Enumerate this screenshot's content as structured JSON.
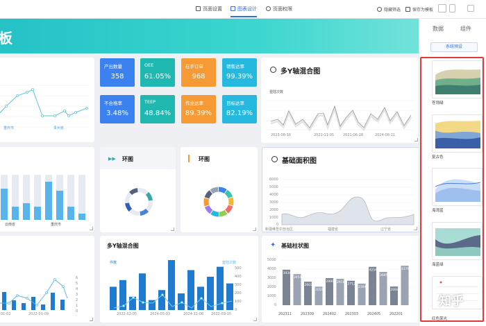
{
  "topbar": {
    "tabs": [
      "页面设置",
      "图表设计",
      "页面权限"
    ],
    "hide_filter": "隐藏筛选",
    "save_template": "保存为模板"
  },
  "banner": {
    "title": "板"
  },
  "line_panel": {
    "x_labels": [
      "重庆市",
      "贵州省"
    ]
  },
  "kpis": [
    {
      "label": "产出数量",
      "value": "358",
      "color": "#3b82f0"
    },
    {
      "label": "OEE",
      "value": "61.05%",
      "color": "#1fb8b0"
    },
    {
      "label": "在手订单",
      "value": "968",
      "color": "#f59a35"
    },
    {
      "label": "销售达率",
      "value": "99.39%",
      "color": "#26b9df"
    },
    {
      "label": "不合格率",
      "value": "3.48%",
      "color": "#3b82f0"
    },
    {
      "label": "TEEP",
      "value": "48.84%",
      "color": "#1fb8b0"
    },
    {
      "label": "作业达率",
      "value": "89.39%",
      "color": "#f59a35"
    },
    {
      "label": "目标达率",
      "value": "82.19%",
      "color": "#26b9df"
    }
  ],
  "multi_y_top": {
    "title": "多Y轴混合图",
    "series_label": "登陆次数",
    "x_labels": [
      "2023-08-16",
      "2021-11-05",
      "2021-06-28",
      "2024-08-21"
    ]
  },
  "bar_left": {
    "x_labels": [
      "云南省",
      "重庆市"
    ]
  },
  "ring1": {
    "title": "环图",
    "colors": [
      "#3b82f0",
      "#37c6a9",
      "#f2b632",
      "#f46d6d",
      "#8fd14f",
      "#26b9df",
      "#a07cf0",
      "#f59a35",
      "#56617a",
      "#94a3b8"
    ]
  },
  "ring2": {
    "title": "环图"
  },
  "area_panel": {
    "title": "基础面积图",
    "y_ticks": [
      "6000",
      "5000",
      "4000",
      "3000",
      "2000",
      "1000",
      "0"
    ],
    "x_labels": [
      "新疆维吾尔自治区",
      "福建省",
      "辽宁省"
    ]
  },
  "bottom_left": {
    "x_labels": [
      "01-02",
      "2022-01-09"
    ],
    "y_ticks": [
      "6",
      "5",
      "4",
      "3",
      "2",
      "1",
      "0"
    ]
  },
  "multi_y_bottom": {
    "title": "多Y轴混合图",
    "left_label": "件数",
    "right_label": "登陆次数",
    "x_labels": [
      "2022-02-05",
      "2024-05-03",
      "2024-12-08",
      "2022-09-15"
    ],
    "y_ticks": [
      "500",
      "400",
      "300",
      "200",
      "100",
      "0"
    ]
  },
  "bar_panel": {
    "title": "基础柱状图",
    "y_ticks": [
      "5000",
      "4000",
      "3000",
      "2000",
      "1000",
      "0"
    ],
    "x_labels": [
      "202311",
      "202309",
      "202402",
      "202303",
      "202405",
      "202201"
    ],
    "bar_values": [
      "3934",
      "3451",
      "2602",
      "2059",
      "2999",
      "2918",
      "2712",
      "2394",
      "4254",
      "3695",
      "2069",
      "4376"
    ]
  },
  "right_panel": {
    "tabs": [
      "数据",
      "组件"
    ],
    "preset_button": "系统预设",
    "themes": [
      "苍翎绿",
      "复古色",
      "海湾蓝",
      "海蓝绿",
      "红色荣光"
    ]
  },
  "watermark": "知乎"
}
